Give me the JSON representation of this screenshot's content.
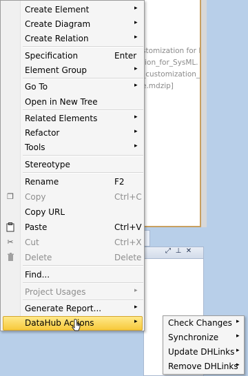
{
  "background": {
    "partial_lines": [
      "stomization for R",
      "tion_for_SysML.",
      "_customization_fo",
      "e.mdzip]"
    ]
  },
  "context_menu": {
    "items": [
      {
        "label": "Create Element",
        "submenu": true
      },
      {
        "label": "Create Diagram",
        "submenu": true
      },
      {
        "label": "Create Relation",
        "submenu": true
      },
      {
        "label": "Specification",
        "shortcut": "Enter"
      },
      {
        "label": "Element Group",
        "submenu": true
      },
      {
        "label": "Go To",
        "submenu": true
      },
      {
        "label": "Open in New Tree"
      },
      {
        "label": "Related Elements",
        "submenu": true
      },
      {
        "label": "Refactor",
        "submenu": true
      },
      {
        "label": "Tools",
        "submenu": true
      },
      {
        "label": "Stereotype"
      },
      {
        "label": "Rename",
        "shortcut": "F2"
      },
      {
        "label": "Copy",
        "shortcut": "Ctrl+C",
        "disabled": true
      },
      {
        "label": "Copy URL"
      },
      {
        "label": "Paste",
        "shortcut": "Ctrl+V"
      },
      {
        "label": "Cut",
        "shortcut": "Ctrl+X",
        "disabled": true
      },
      {
        "label": "Delete",
        "shortcut": "Delete",
        "disabled": true
      },
      {
        "label": "Find..."
      },
      {
        "label": "Project Usages",
        "submenu": true,
        "disabled": true
      },
      {
        "label": "Generate Report...",
        "submenu": true
      },
      {
        "label": "DataHub Actions",
        "submenu": true,
        "highlighted": true
      }
    ]
  },
  "datahub_submenu": {
    "items": [
      {
        "label": "Check Changes",
        "submenu": true
      },
      {
        "label": "Synchronize",
        "submenu": true
      },
      {
        "label": "Update DHLinks",
        "submenu": true
      },
      {
        "label": "Remove DHLinks",
        "submenu": true
      }
    ]
  },
  "colors": {
    "highlight": "#f7c93b",
    "menu_bg": "#f5f5f5",
    "disabled_text": "#8d8d8d",
    "desktop_bg": "#b8cfe9"
  },
  "icons": {
    "arrow": "▸",
    "copy_icon": "❐",
    "paste_icon": "📋",
    "cut_icon": "✂",
    "delete_icon": "🗑",
    "panel_float": "⤢",
    "panel_pin": "⊥",
    "panel_close": "✕"
  }
}
